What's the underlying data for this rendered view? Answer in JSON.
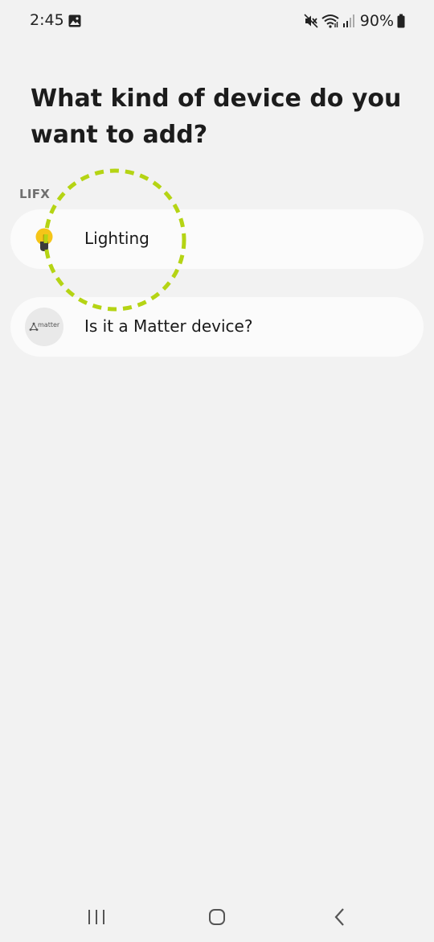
{
  "status_bar": {
    "time": "2:45",
    "battery": "90%",
    "icons": [
      "gallery-icon",
      "mute-icon",
      "wifi-icon",
      "signal-icon",
      "battery-icon"
    ]
  },
  "page": {
    "title": "What kind of device do you want to add?"
  },
  "sections": [
    {
      "label": "LIFX",
      "items": [
        {
          "label": "Lighting",
          "icon": "light-bulb-icon"
        }
      ]
    },
    {
      "label": "",
      "items": [
        {
          "label": "Is it a Matter device?",
          "icon": "matter-logo-icon",
          "logo_text": "matter"
        }
      ]
    }
  ],
  "highlight": {
    "target": "Lighting",
    "color": "#b5d414"
  },
  "nav_bar": {
    "buttons": [
      "recents-icon",
      "home-icon",
      "back-icon"
    ]
  },
  "colors": {
    "background": "#f2f2f2",
    "card": "#fbfbfb",
    "bulb": "#f5c518"
  }
}
